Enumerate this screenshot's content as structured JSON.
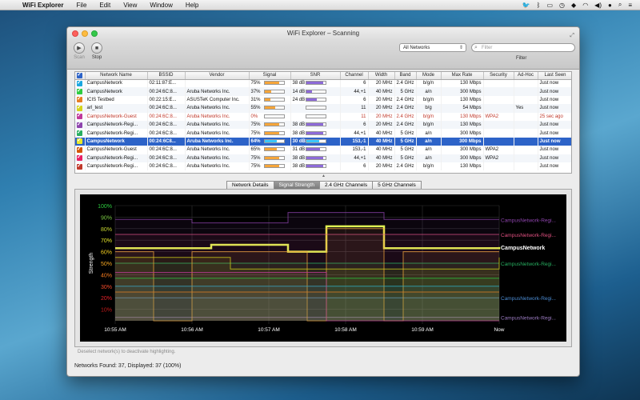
{
  "menubar": {
    "app_name": "WiFi Explorer",
    "items": [
      "File",
      "Edit",
      "View",
      "Window",
      "Help"
    ],
    "right_icons": [
      "twitter-icon",
      "bluetooth-icon",
      "airplay-icon",
      "timemachine-icon",
      "dropbox-icon",
      "wifi-icon",
      "volume-icon",
      "user-icon",
      "search-icon",
      "list-icon"
    ]
  },
  "window": {
    "title": "WiFi Explorer – Scanning",
    "toolbar": {
      "scan_label": "Scan",
      "stop_label": "Stop",
      "networks_select": "All Networks",
      "filter_placeholder": "Filter",
      "filter_label": "Filter"
    },
    "table": {
      "columns": [
        "",
        "Network Name",
        "BSSID",
        "Vendor",
        "Signal",
        "SNR",
        "Channel",
        "Width",
        "Band",
        "Mode",
        "Max Rate",
        "Security",
        "Ad-Hoc",
        "Last Seen"
      ],
      "rows": [
        {
          "color": "#1aa7e0",
          "name": "CampusNetwork",
          "bssid": "02:11:87:E...",
          "vendor": "",
          "signal": "75%",
          "signal_fraction": 0.75,
          "snr": "38 dB",
          "snr_fraction": 0.9,
          "channel": "6",
          "width": "20 MHz",
          "band": "2.4 GHz",
          "mode": "b/g/n",
          "max_rate": "130 Mbps",
          "security": "",
          "adhoc": "",
          "last_seen": "Just now",
          "state": "normal"
        },
        {
          "color": "#2ecc40",
          "name": "CampusNetwork",
          "bssid": "00:24:6C:8...",
          "vendor": "Aruba Networks Inc.",
          "signal": "37%",
          "signal_fraction": 0.37,
          "snr": "14 dB",
          "snr_fraction": 0.3,
          "channel": "44,+1",
          "width": "40 MHz",
          "band": "5 GHz",
          "mode": "a/n",
          "max_rate": "300 Mbps",
          "security": "",
          "adhoc": "",
          "last_seen": "Just now",
          "state": "normal"
        },
        {
          "color": "#e67e22",
          "name": "ICIS Testbed",
          "bssid": "00:22:15:E...",
          "vendor": "ASUSTeK Computer Inc.",
          "signal": "31%",
          "signal_fraction": 0.31,
          "snr": "24 dB",
          "snr_fraction": 0.55,
          "channel": "6",
          "width": "20 MHz",
          "band": "2.4 GHz",
          "mode": "b/g/n",
          "max_rate": "130 Mbps",
          "security": "",
          "adhoc": "",
          "last_seen": "Just now",
          "state": "normal"
        },
        {
          "color": "#d4d41a",
          "name": "arl_test",
          "bssid": "00:24:6C:8...",
          "vendor": "Aruba Networks Inc.",
          "signal": "55%",
          "signal_fraction": 0.55,
          "snr": "",
          "snr_fraction": 0,
          "channel": "11",
          "width": "20 MHz",
          "band": "2.4 GHz",
          "mode": "b/g",
          "max_rate": "54 Mbps",
          "security": "",
          "adhoc": "Yes",
          "last_seen": "Just now",
          "state": "normal"
        },
        {
          "color": "#c0399b",
          "name": "CampusNetwork-Guest",
          "bssid": "00:24:6C:8...",
          "vendor": "Aruba Networks Inc.",
          "signal": "0%",
          "signal_fraction": 0,
          "snr": "",
          "snr_fraction": 0,
          "channel": "11",
          "width": "20 MHz",
          "band": "2.4 GHz",
          "mode": "b/g/n",
          "max_rate": "130 Mbps",
          "security": "WPA2",
          "adhoc": "",
          "last_seen": "25 sec ago",
          "state": "inactive"
        },
        {
          "color": "#8e44ad",
          "name": "CampusNetwork-Regi...",
          "bssid": "00:24:6C:8...",
          "vendor": "Aruba Networks Inc.",
          "signal": "75%",
          "signal_fraction": 0.75,
          "snr": "38 dB",
          "snr_fraction": 0.9,
          "channel": "6",
          "width": "20 MHz",
          "band": "2.4 GHz",
          "mode": "b/g/n",
          "max_rate": "130 Mbps",
          "security": "",
          "adhoc": "",
          "last_seen": "Just now",
          "state": "normal"
        },
        {
          "color": "#27ae60",
          "name": "CampusNetwork-Regi...",
          "bssid": "00:24:6C:8...",
          "vendor": "Aruba Networks Inc.",
          "signal": "75%",
          "signal_fraction": 0.75,
          "snr": "38 dB",
          "snr_fraction": 0.9,
          "channel": "44,+1",
          "width": "40 MHz",
          "band": "5 GHz",
          "mode": "a/n",
          "max_rate": "300 Mbps",
          "security": "",
          "adhoc": "",
          "last_seen": "Just now",
          "state": "normal"
        },
        {
          "color": "#e8e82a",
          "name": "CampusNetwork",
          "bssid": "00:24:6C8...",
          "vendor": "Aruba Networks Inc.",
          "signal": "64%",
          "signal_fraction": 0.64,
          "snr": "30 dB",
          "snr_fraction": 0.7,
          "channel": "153,-1",
          "width": "40 MHz",
          "band": "5 GHz",
          "mode": "a/n",
          "max_rate": "300 Mbps",
          "security": "",
          "adhoc": "",
          "last_seen": "Just now",
          "state": "selected"
        },
        {
          "color": "#d35400",
          "name": "CampusNetwork-Guest",
          "bssid": "00:24:6C:8...",
          "vendor": "Aruba Networks Inc.",
          "signal": "65%",
          "signal_fraction": 0.65,
          "snr": "31 dB",
          "snr_fraction": 0.72,
          "channel": "153,-1",
          "width": "40 MHz",
          "band": "5 GHz",
          "mode": "a/n",
          "max_rate": "300 Mbps",
          "security": "WPA2",
          "adhoc": "",
          "last_seen": "Just now",
          "state": "normal"
        },
        {
          "color": "#e91e63",
          "name": "CampusNetwork-Regi...",
          "bssid": "00:24:6C:8...",
          "vendor": "Aruba Networks Inc.",
          "signal": "75%",
          "signal_fraction": 0.75,
          "snr": "38 dB",
          "snr_fraction": 0.9,
          "channel": "44,+1",
          "width": "40 MHz",
          "band": "5 GHz",
          "mode": "a/n",
          "max_rate": "300 Mbps",
          "security": "WPA2",
          "adhoc": "",
          "last_seen": "Just now",
          "state": "normal"
        },
        {
          "color": "#c0392b",
          "name": "CampusNetwork-Regi...",
          "bssid": "00:24:6C:8...",
          "vendor": "Aruba Networks Inc.",
          "signal": "75%",
          "signal_fraction": 0.75,
          "snr": "38 dB",
          "snr_fraction": 0.9,
          "channel": "6",
          "width": "20 MHz",
          "band": "2.4 GHz",
          "mode": "b/g/n",
          "max_rate": "130 Mbps",
          "security": "",
          "adhoc": "",
          "last_seen": "Just now",
          "state": "normal"
        }
      ]
    },
    "tabs": [
      "Network Details",
      "Signal Strength",
      "2.4 GHz Channels",
      "5 GHz Channels"
    ],
    "active_tab": 1,
    "hint": "Deselect network(s) to deactivate highlighting.",
    "status": "Networks Found: 37, Displayed: 37 (100%)"
  },
  "chart_data": {
    "type": "line",
    "ylabel": "Strength",
    "x": [
      "10:55 AM",
      "10:56 AM",
      "10:57 AM",
      "10:58 AM",
      "10:59 AM",
      "Now"
    ],
    "y_ticks": [
      "100%",
      "90%",
      "80%",
      "70%",
      "60%",
      "50%",
      "40%",
      "30%",
      "20%",
      "10%"
    ],
    "ylim": [
      0,
      100
    ],
    "series": [
      {
        "name": "CampusNetwork",
        "color": "#e8ff4a",
        "highlight": true,
        "values": [
          63,
          63,
          63,
          63,
          63,
          66,
          66,
          66,
          66,
          60,
          60,
          82,
          82,
          82,
          63,
          63,
          63,
          63,
          63,
          63,
          64
        ]
      },
      {
        "name": "CampusNetwork-Regi...",
        "color": "#e05080",
        "values": [
          75,
          75,
          75,
          75,
          75,
          75,
          75,
          75,
          75,
          75,
          75,
          75,
          75,
          75,
          75,
          75,
          75,
          75,
          75,
          75,
          75
        ]
      },
      {
        "name": "CampusNetwork-Regi...",
        "color": "#8e44ad",
        "values": [
          88,
          88,
          88,
          88,
          85,
          85,
          85,
          85,
          85,
          94,
          94,
          94,
          94,
          94,
          88,
          88,
          88,
          88,
          88,
          88,
          88
        ]
      },
      {
        "name": "CampusNetwork-Regi...",
        "color": "#27ae60",
        "values": [
          50,
          50,
          50,
          50,
          50,
          50,
          50,
          50,
          50,
          50,
          50,
          50,
          50,
          50,
          50,
          50,
          50,
          50,
          50,
          50,
          50
        ]
      },
      {
        "name": "CampusNetwork-Regi...",
        "color": "#4a8ad0",
        "values": [
          20,
          20,
          20,
          20,
          20,
          20,
          20,
          20,
          20,
          20,
          20,
          20,
          20,
          20,
          20,
          20,
          20,
          20,
          20,
          20,
          20
        ]
      },
      {
        "name": "CampusNetwork-Regi...",
        "color": "#9a7ac0",
        "values": [
          3,
          3,
          3,
          3,
          3,
          3,
          3,
          3,
          3,
          3,
          3,
          3,
          3,
          3,
          3,
          3,
          3,
          3,
          3,
          3,
          3
        ]
      },
      {
        "name": "",
        "color": "#f5a53a",
        "values": [
          60,
          60,
          0,
          0,
          60,
          60,
          60,
          60,
          60,
          60,
          0,
          80,
          80,
          80,
          0,
          60,
          60,
          60,
          60,
          60,
          60
        ]
      },
      {
        "name": "",
        "color": "#1aa7e0",
        "values": [
          30,
          30,
          30,
          30,
          30,
          30,
          30,
          30,
          30,
          30,
          30,
          30,
          30,
          30,
          30,
          30,
          30,
          30,
          30,
          30,
          30
        ]
      },
      {
        "name": "",
        "color": "#d4d41a",
        "values": [
          55,
          55,
          55,
          55,
          55,
          55,
          45,
          45,
          45,
          45,
          45,
          45,
          45,
          45,
          45,
          45,
          45,
          45,
          45,
          45,
          55
        ]
      },
      {
        "name": "",
        "color": "#c0399b",
        "values": [
          42,
          42,
          42,
          42,
          42,
          42,
          42,
          42,
          42,
          42,
          42,
          0,
          0,
          0,
          0,
          0,
          0,
          0,
          0,
          0,
          0
        ]
      },
      {
        "name": "",
        "color": "#2ecc40",
        "values": [
          37,
          37,
          37,
          37,
          37,
          37,
          37,
          37,
          37,
          37,
          37,
          37,
          37,
          37,
          37,
          37,
          37,
          37,
          37,
          37,
          37
        ]
      },
      {
        "name": "",
        "color": "#e67e22",
        "values": [
          25,
          25,
          25,
          25,
          25,
          25,
          25,
          25,
          25,
          25,
          25,
          25,
          25,
          25,
          25,
          25,
          25,
          25,
          25,
          25,
          25
        ]
      }
    ]
  }
}
